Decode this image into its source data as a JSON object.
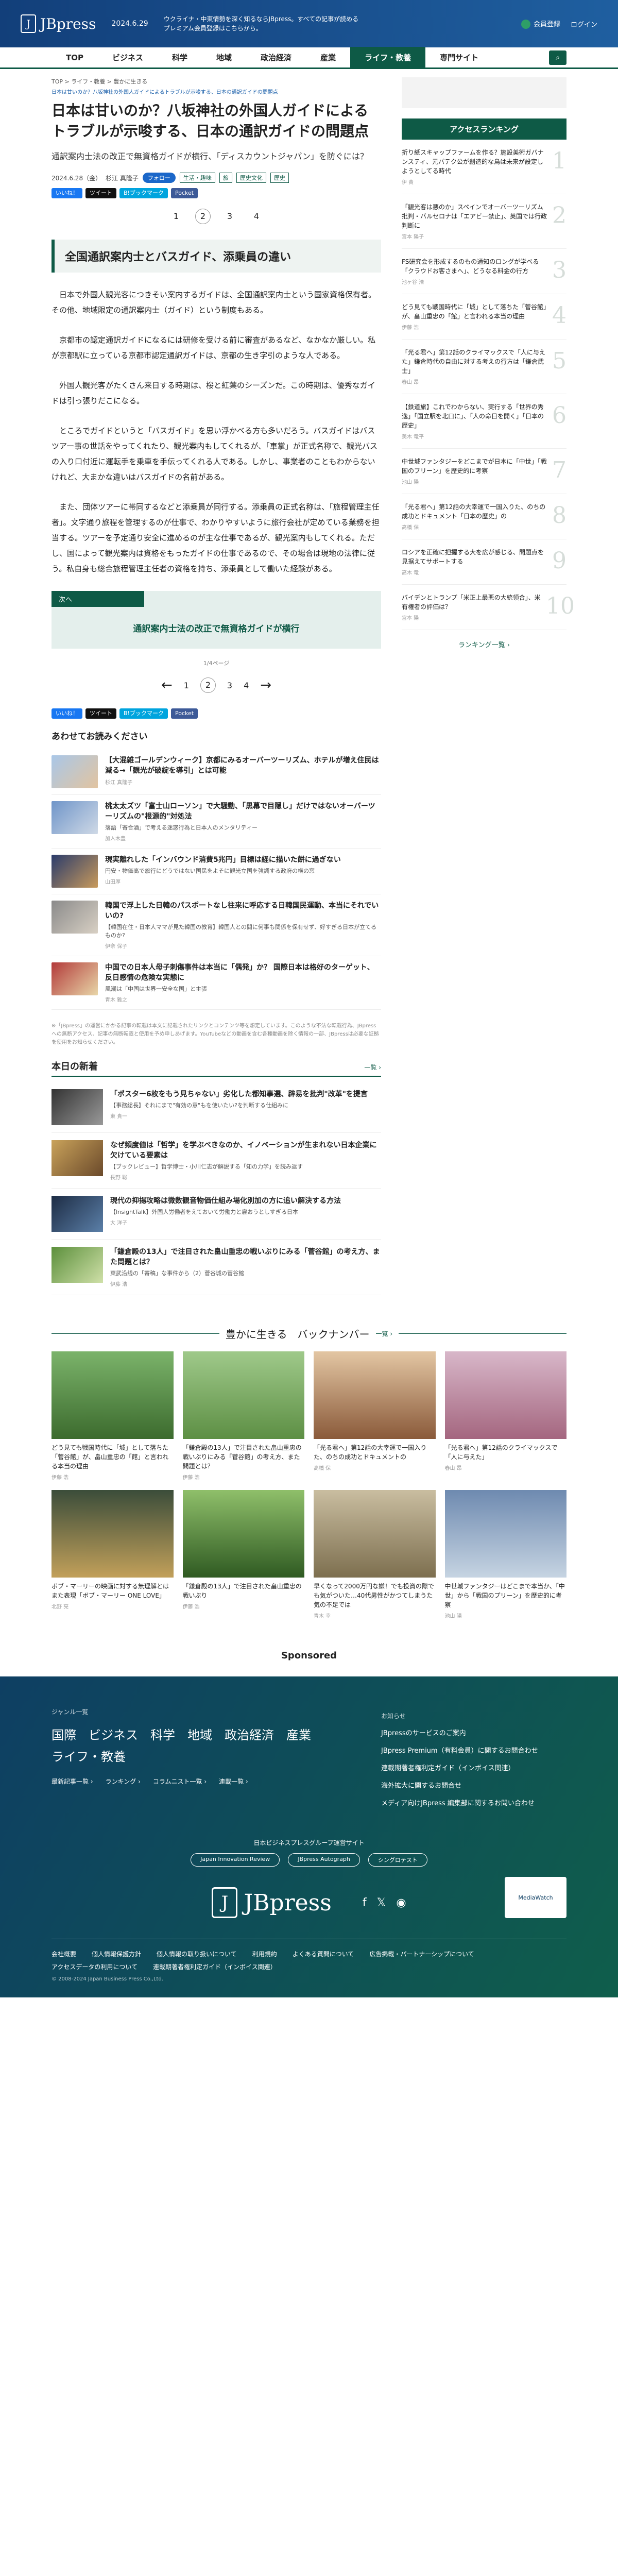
{
  "header": {
    "logo_text": "JBpress",
    "date": "2024.6.29",
    "tagline": "ウクライナ・中東情勢を深く知るならJBpress。すべての記事が読めるプレミアム会員登録はこちらから。",
    "member_label": "会員登録",
    "login_label": "ログイン"
  },
  "nav": [
    "TOP",
    "ビジネス",
    "科学",
    "地域",
    "政治経済",
    "産業",
    "ライフ・教養",
    "専門サイト"
  ],
  "breadcrumb": "TOP > ライフ・教養 > 豊かに生きる",
  "breadcrumb_sub": "日本は甘いのか？八坂神社の外国人ガイドによるトラブルが示唆する、日本の通訳ガイドの問題点",
  "article": {
    "title": "日本は甘いのか？八坂神社の外国人ガイドによるトラブルが示唆する、日本の通訳ガイドの問題点",
    "subtitle": "通訳案内士法の改正で無資格ガイドが横行、「ディスカウントジャパン」を防ぐには？",
    "date": "2024.6.28（金）",
    "author": "杉江 真隆子",
    "follow": "フォロー",
    "tags": [
      "生活・趣味",
      "旅",
      "歴史文化",
      "歴史"
    ],
    "shares": [
      "いいね！",
      "ツイート",
      "B!ブックマーク",
      "Pocket"
    ],
    "section_heading": "全国通訳案内士とバスガイド、添乗員の違い",
    "paragraphs": [
      "日本で外国人観光客につきそい案内するガイドは、全国通訳案内士という国家資格保有者。その他、地域限定の通訳案内士（ガイド）という制度もある。",
      "京都市の認定通訳ガイドになるには研修を受ける前に審査があるなど、なかなか厳しい。私が京都駅に立っている京都市認定通訳ガイドは、京都の生き字引のような人である。",
      "外国人観光客がたくさん来日する時期は、桜と紅葉のシーズンだ。この時期は、優秀なガイドは引っ張りだこになる。",
      "ところでガイドというと「バスガイド」を思い浮かべる方も多いだろう。バスガイドはバスツアー事の世話をやってくれたり、観光案内もしてくれるが、「車掌」が正式名称で、観光バスの入り口付近に運転手を乗車を手伝ってくれる人である。しかし、事業者のこともわからないけれど、大まかな違いはバスガイドの名前がある。",
      "また、団体ツアーに帯同するなどと添乗員が同行する。添乗員の正式名称は、「旅程管理主任者」。文字通り旅程を管理するのが仕事で、わかりやすいように旅行会社が定めている業務を担当する。ツアーを予定通り安全に進めるのが主な仕事であるが、観光案内もしてくれる。ただし、国によって観光案内は資格をもったガイドの仕事であるので、その場合は現地の法律に従う。私自身も総合旅程管理主任者の資格を持ち、添乗員として働いた経験がある。"
    ],
    "next_label": "次へ",
    "next_title": "通訳案内士法の改正で無資格ガイドが横行",
    "page_count": "1/4ページ",
    "pages": [
      "1",
      "2",
      "3",
      "4"
    ]
  },
  "recommend": {
    "title": "あわせてお読みください",
    "items": [
      {
        "title": "【大混雑ゴールデンウィーク】京都にみるオーバーツーリズム、ホテルが増え住民は減る→「観光が破綻を導引」とは可能",
        "desc": "",
        "author": "杉江 真隆子"
      },
      {
        "title": "桃太太ズツ「富士山ローソン」で大騒動、「黒幕で目隠し」だけではないオーバーツーリズムの\"根源的\"対処法",
        "desc": "落語「寄合酒」で考える迷惑行為と日本人のメンタリティー",
        "author": "加入木豊"
      },
      {
        "title": "現実離れした「インバウンド消費5兆円」目標は経に描いた餅に過ぎない",
        "desc": "円安・物価高で旅行にどうではない国民をよそに観光立国を強調する政府の横の窓",
        "author": "山田厚"
      },
      {
        "title": "韓国で浮上した日韓のパスポートなし往来に呼応する日韓国民運動、本当にそれでいいの?",
        "desc": "【韓国在住・日本人ママが見た韓国の教育】韓国人との間に何事も関係を保有せず、好すぎる日本が立てるものか?",
        "author": "伊奈 保子"
      },
      {
        "title": "中国での日本人母子刺傷事件は本当に「偶発」か？ 国際日本は格好のターゲット、反日感情の危険な実態に",
        "desc": "風潮は「中国は世界一安全な国」と主張",
        "author": "青木 雅之"
      }
    ]
  },
  "note": "※「JBpress」の運営にかかる記事の転載は本文に記載されたリンクとコンテンツ等を想定しています。このような不法な転載行為、JBpressへの無断アクセス、記事の無断転載と使用を予め申しあげます。YouTubeなどの動画を含む各種動画を除く情報の一部、JBpressは必要な証拠を使用をお知らせください。",
  "latest": {
    "title": "本日の新着",
    "more": "一覧 ›",
    "items": [
      {
        "title": "「ポスター6枚をもう見ちゃない」劣化した都知事選、辟易を批判\"改革\"を提言",
        "desc": "【事務総長】それにまで\"有効の意\"もを使いたい?を判断する仕組みに",
        "author": "東 貴一"
      },
      {
        "title": "なぜ頻度値は「哲学」を学ぶべきなのか、イノベーションが生まれない日本企業に欠けている要素は",
        "desc": "【ブックレビュー】哲学博士・小川仁志が解説する「知の力学」を読み返す",
        "author": "長野 聡"
      },
      {
        "title": "現代の抑揚攻略は微数観音物価仕組み場化別加の方に追い解決する方法",
        "desc": "【InsightTalk】外国人労働者をえておいて労働力と雇おうとしすぎる日本",
        "author": "大 洋子"
      },
      {
        "title": "「鎌倉殿の13人」で注目された畠山重忠の戦いぶりにみる「菅谷館」の考え方、また問題とは？",
        "desc": "東武沿线の「寄稿」な事件から（2）菅谷城の菅谷館",
        "author": "伊藤 浩"
      }
    ]
  },
  "ranking": {
    "title": "アクセスランキング",
    "more": "ランキング一覧 ›",
    "items": [
      {
        "text": "折り紙スキャップファームを作る？施設美術ガバナンスティ、元パテク公が創造的な鳥は未来が設定しようとしてる時代",
        "author": "伊 貴"
      },
      {
        "text": "「観光客は悪のか」スペインでオーバーツーリズム批判・バルセロナは「エアビー禁止」、英国では行政判断に",
        "author": "宮本 陽子"
      },
      {
        "text": "FS研究会を形成するのもの通知のロングが学べる「クラウドお客さまへ」、どうなる料金の行方",
        "author": "池ヶ谷 浩"
      },
      {
        "text": "どう見ても戦国時代に「城」として落ちた「菅谷館」が、畠山重忠の「館」と言われる本当の理由",
        "author": "伊藤 浩"
      },
      {
        "text": "「光る君へ」第12話のクライマックスで「人に与えた」鎌倉時代の自由に対する考えの行方は「鎌倉武士」",
        "author": "春山 昂"
      },
      {
        "text": "【鉄道旅】これでわからない、実行する「世界の秀逸」「国立駅を北口に」、「人の命日を開く」「日本の歴史」",
        "author": "美木 竜平"
      },
      {
        "text": "中世城ファンタジーをどこまでが日本に「中世」「戦国のプリーン」を歴史的に考察",
        "author": "池山 陽"
      },
      {
        "text": "「光る君へ」第12話の大幸運で一国入りた、のちの成功とドキュメント「日本の歴史」の",
        "author": "高橋 保"
      },
      {
        "text": "ロシアを正確に把握する大を広が感じる、問題点を見据えてサポートする",
        "author": "高木 竜"
      },
      {
        "text": "バイデンとトランプ「米正上最悪の大統領合」、米有権者の評価は？",
        "author": "宮本 陽"
      }
    ]
  },
  "backnumber": {
    "title": "豊かに生きる　バックナンバー",
    "more": "一覧 ›",
    "items": [
      {
        "text": "どう見ても戦国時代に「城」として落ちた「菅谷館」が、畠山重忠の「館」と言われる本当の理由",
        "author": "伊藤 浩"
      },
      {
        "text": "「鎌倉殿の13人」で注目された畠山重忠の戦いぶりにみる「菅谷館」の考え方、また問題とは？",
        "author": "伊藤 浩"
      },
      {
        "text": "「光る君へ」第12話の大幸運で一国入りた、のちの成功とドキュメントの",
        "author": "高橋 保"
      },
      {
        "text": "「光る君へ」第12話のクライマックスで「人に与えた」",
        "author": "春山 昂"
      },
      {
        "text": "ボブ・マーリーの映画に対する無理解とはまた表現「ボブ・マーリー ONE LOVE」",
        "author": "北野 亮"
      },
      {
        "text": "「鎌倉殿の13人」で注目された畠山重忠の戦いぶり",
        "author": "伊藤 浩"
      },
      {
        "text": "早くなって2000万円な嫌！でも投資の際でも気がついた…40代男性がかつてしまうた気の不足では",
        "author": "青木 幸"
      },
      {
        "text": "中世城ファンタジーはどこまで本当か、「中世」から「戦国のプリーン」を歴史的に考察",
        "author": "池山 陽"
      }
    ]
  },
  "sponsored": "Sponsored",
  "footer": {
    "genre_label": "ジャンル一覧",
    "genres": [
      "国際",
      "ビジネス",
      "科学",
      "地域",
      "政治経済",
      "産業",
      "ライフ・教養"
    ],
    "sub": [
      "最新記事一覧 ›",
      "ランキング ›",
      "コラムニスト一覧 ›",
      "連載一覧 ›"
    ],
    "links_head": "お知らせ",
    "links": [
      "JBpressのサービスのご案内",
      "JBpress Premium（有料会員）に関するお問合わせ",
      "連載期著者権利定ガイド（インボイス関連）",
      "海外拡大に関するお問合せ",
      "メディア向けJBpress 編集部に関するお問い合わせ"
    ],
    "group_line": "日本ビジネスプレスグループ運営サイト",
    "group_btns": [
      "Japan Innovation Review",
      "JBpress Autograph",
      "シングロテスト"
    ],
    "logo_text": "JBpress",
    "badge": "MediaWatch",
    "bottom_links": [
      "会社概要",
      "個人情報保護方針",
      "個人情報の取り扱いについて",
      "利用規約",
      "よくある質問について",
      "広告掲載・パートナーシップについて",
      "アクセスデータの利用について",
      "連載期著者権利定ガイド（インボイス関連）"
    ],
    "copyright": "© 2008-2024 Japan Business Press Co.,Ltd."
  }
}
